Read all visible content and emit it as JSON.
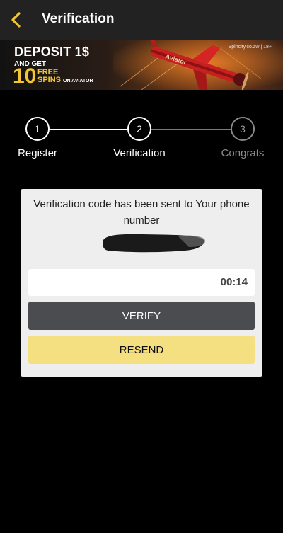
{
  "header": {
    "title": "Verification",
    "back_icon": "chevron-left-icon",
    "accent": "#f3c733"
  },
  "banner": {
    "line1": "DEPOSIT 1$",
    "line2": "AND GET",
    "big_number": "10",
    "free": "FREE",
    "spins": "SPINS",
    "on_aviator": "ON AVIATOR",
    "site": "Spincity.co.zw | 18+",
    "plane_label": "Aviator"
  },
  "steps": [
    {
      "number": "1",
      "label": "Register",
      "state": "done"
    },
    {
      "number": "2",
      "label": "Verification",
      "state": "active"
    },
    {
      "number": "3",
      "label": "Congrats",
      "state": "inactive"
    }
  ],
  "card": {
    "message": "Verification code has been sent to Your phone number",
    "code_placeholder": "",
    "timer": "00:14",
    "verify_label": "VERIFY",
    "resend_label": "RESEND"
  }
}
